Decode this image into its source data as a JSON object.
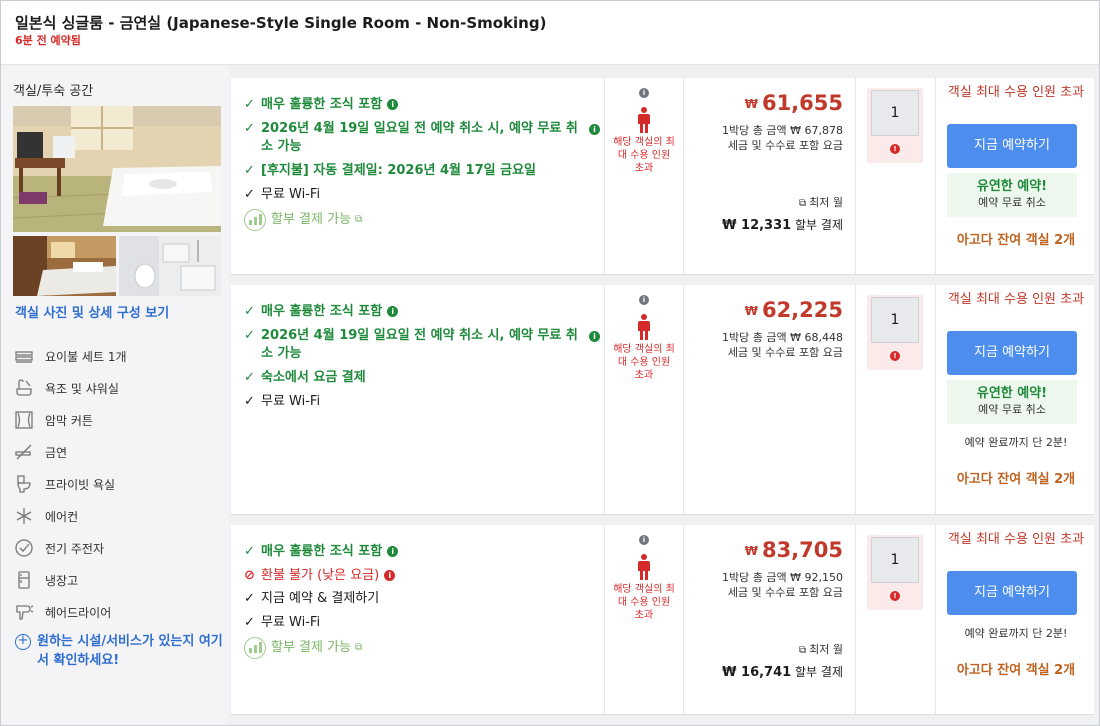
{
  "header": {
    "title": "일본식 싱글룸 - 금연실 (Japanese-Style Single Room - Non-Smoking)",
    "booked_ago": "6분 전 예약됨"
  },
  "sidebar": {
    "section_title": "객실/투숙 공간",
    "photos_link": "객실 사진 및 상세 구성 보기",
    "amenities": [
      {
        "icon": "bedding-icon",
        "label": "요이불 세트 1개"
      },
      {
        "icon": "bath-shower-icon",
        "label": "욕조 및 샤워실"
      },
      {
        "icon": "blackout-curtain-icon",
        "label": "암막 커튼"
      },
      {
        "icon": "no-smoking-icon",
        "label": "금연"
      },
      {
        "icon": "private-bathroom-icon",
        "label": "프라이빗 욕실"
      },
      {
        "icon": "air-conditioner-icon",
        "label": "에어컨"
      },
      {
        "icon": "electric-kettle-icon",
        "label": "전기 주전자"
      },
      {
        "icon": "refrigerator-icon",
        "label": "냉장고"
      },
      {
        "icon": "hair-dryer-icon",
        "label": "헤어드라이어"
      }
    ],
    "more_facilities": "원하는 시설/서비스가 있는지 여기서 확인하세요!"
  },
  "offers": [
    {
      "benefits": [
        {
          "type": "green",
          "text": "매우 훌륭한 조식 포함",
          "info": true
        },
        {
          "type": "green",
          "text": "2026년 4월 19일 일요일 전 예약 취소 시, 예약 무료 취소 가능",
          "info": true
        },
        {
          "type": "green",
          "text": "[후지불] 자동 결제일: 2026년 4월 17일 금요일",
          "info": false
        },
        {
          "type": "plain",
          "text": "무료 Wi-Fi",
          "info": false
        },
        {
          "type": "inst",
          "text": "할부 결제 가능",
          "info": false
        }
      ],
      "occupancy_warning": "해당 객실의 최대 수용 인원 초과",
      "currency": "₩",
      "price": "61,655",
      "per_night_total": "1박당 총 금액 ₩ 67,878",
      "tax_note": "세금 및 수수료 포함 요금",
      "min_month": "최저 월",
      "installment": "₩ 12,331",
      "installment_label": "할부 결제",
      "quantity": "1",
      "capacity_warning": "객실 최대 수용 인원 초과",
      "book_label": "지금 예약하기",
      "flexible_title": "유연한 예약!",
      "flexible_sub": "예약 무료 취소",
      "last_minutes": "",
      "rooms_left": "아고다 잔여 객실 2개"
    },
    {
      "benefits": [
        {
          "type": "green",
          "text": "매우 훌륭한 조식 포함",
          "info": true
        },
        {
          "type": "green",
          "text": "2026년 4월 19일 일요일 전 예약 취소 시, 예약 무료 취소 가능",
          "info": true
        },
        {
          "type": "green",
          "text": "숙소에서 요금 결제",
          "info": false
        },
        {
          "type": "plain",
          "text": "무료 Wi-Fi",
          "info": false
        }
      ],
      "occupancy_warning": "해당 객실의 최대 수용 인원 초과",
      "currency": "₩",
      "price": "62,225",
      "per_night_total": "1박당 총 금액 ₩ 68,448",
      "tax_note": "세금 및 수수료 포함 요금",
      "quantity": "1",
      "capacity_warning": "객실 최대 수용 인원 초과",
      "book_label": "지금 예약하기",
      "flexible_title": "유연한 예약!",
      "flexible_sub": "예약 무료 취소",
      "last_minutes": "예약 완료까지 단 2분!",
      "rooms_left": "아고다 잔여 객실 2개"
    },
    {
      "benefits": [
        {
          "type": "green",
          "text": "매우 훌륭한 조식 포함",
          "info": true
        },
        {
          "type": "red",
          "text": "환불 불가 (낮은 요금)",
          "info": true
        },
        {
          "type": "plain",
          "text": "지금 예약 & 결제하기",
          "info": false
        },
        {
          "type": "plain",
          "text": "무료 Wi-Fi",
          "info": false
        },
        {
          "type": "inst",
          "text": "할부 결제 가능",
          "info": false
        }
      ],
      "occupancy_warning": "해당 객실의 최대 수용 인원 초과",
      "currency": "₩",
      "price": "83,705",
      "per_night_total": "1박당 총 금액 ₩ 92,150",
      "tax_note": "세금 및 수수료 포함 요금",
      "min_month": "최저 월",
      "installment": "₩ 16,741",
      "installment_label": "할부 결제",
      "quantity": "1",
      "capacity_warning": "객실 최대 수용 인원 초과",
      "book_label": "지금 예약하기",
      "last_minutes": "예약 완료까지 단 2분!",
      "rooms_left": "아고다 잔여 객실 2개"
    }
  ],
  "colors": {
    "accent_blue": "#4c8ded",
    "link_blue": "#2f6ed1",
    "benefit_green": "#1f8a3b",
    "price_red": "#c0392b",
    "warning_orange": "#c0621f"
  }
}
